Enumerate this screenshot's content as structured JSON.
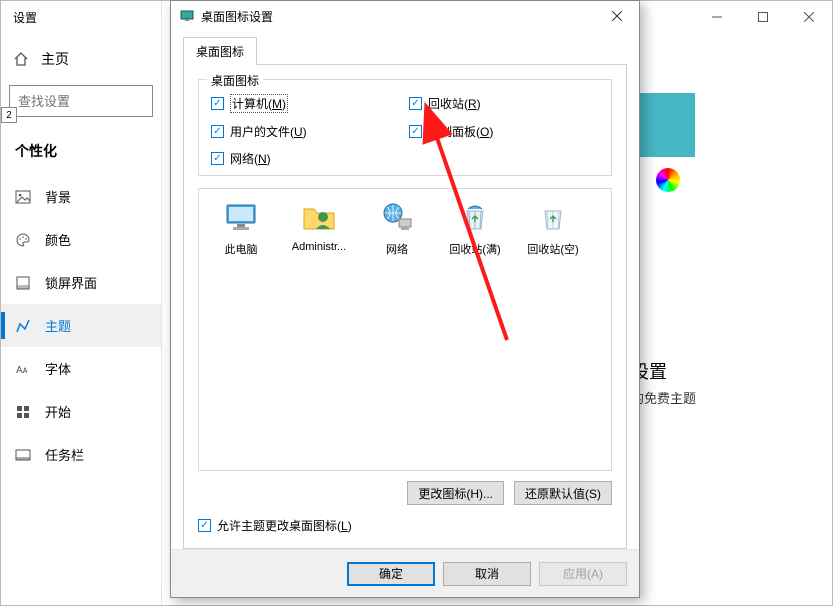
{
  "settings_window": {
    "title": "设置",
    "home": "主页",
    "search_placeholder": "查找设置",
    "section_header": "个性化",
    "nav": [
      {
        "label": "背景"
      },
      {
        "label": "颜色"
      },
      {
        "label": "锁屏界面"
      },
      {
        "label": "主题"
      },
      {
        "label": "字体"
      },
      {
        "label": "开始"
      },
      {
        "label": "任务栏"
      }
    ],
    "related_title": "设置",
    "related_sub": "的免费主题"
  },
  "dialog": {
    "title": "桌面图标设置",
    "tab": "桌面图标",
    "group_legend": "桌面图标",
    "checks": {
      "computer": {
        "label": "计算机(",
        "key": "M",
        "suffix": ")"
      },
      "recycle": {
        "label": "回收站(",
        "key": "R",
        "suffix": ")"
      },
      "userfiles": {
        "label": "用户的文件(",
        "key": "U",
        "suffix": ")"
      },
      "ctrlpanel": {
        "label": "控制面板(",
        "key": "O",
        "suffix": ")"
      },
      "network": {
        "label": "网络(",
        "key": "N",
        "suffix": ")"
      }
    },
    "icons": [
      {
        "name": "此电脑"
      },
      {
        "name": "Administr..."
      },
      {
        "name": "网络"
      },
      {
        "name": "回收站(满)"
      },
      {
        "name": "回收站(空)"
      }
    ],
    "change_icon_btn": "更改图标(H)...",
    "restore_btn": "还原默认值(S)",
    "allow_themes": {
      "label": "允许主题更改桌面图标(",
      "key": "L",
      "suffix": ")"
    },
    "footer": {
      "ok": "确定",
      "cancel": "取消",
      "apply": "应用(A)"
    }
  }
}
